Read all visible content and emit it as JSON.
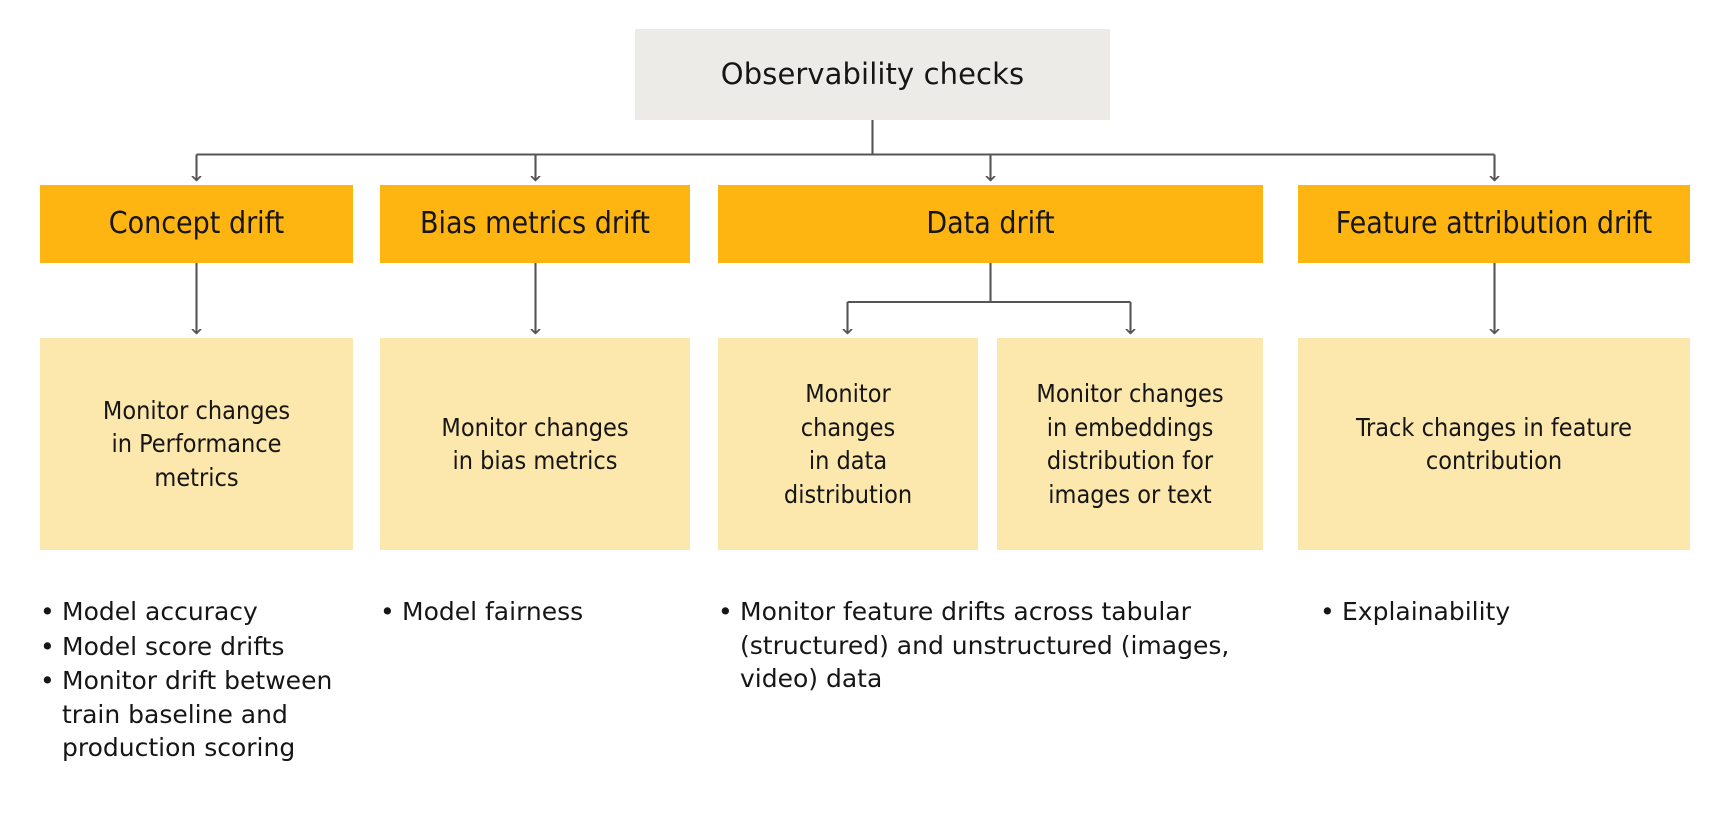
{
  "diagram": {
    "type": "hierarchy-tree",
    "root": {
      "label": "Observability checks",
      "fill": "#ecebe8"
    },
    "colors": {
      "root_fill": "#ecebe8",
      "level1_fill": "#ffb511",
      "level2_fill": "#fce7ad",
      "connector_stroke": "#555555",
      "text": "#161616",
      "background": "#ffffff"
    },
    "columns": [
      {
        "id": "concept-drift",
        "level1": "Concept drift",
        "level2": [
          "Monitor changes\nin Performance\nmetrics"
        ],
        "bullets": [
          "Model accuracy",
          "Model score drifts",
          "Monitor drift between train baseline and production scoring"
        ]
      },
      {
        "id": "bias-metrics-drift",
        "level1": "Bias metrics drift",
        "level2": [
          "Monitor changes\nin bias metrics"
        ],
        "bullets": [
          "Model fairness"
        ]
      },
      {
        "id": "data-drift",
        "level1": "Data drift",
        "level2": [
          "Monitor\nchanges\nin data\ndistribution",
          "Monitor changes\nin embeddings\ndistribution for\nimages or text"
        ],
        "bullets": [
          "Monitor feature drifts across tabular (structured) and unstructured (images, video) data"
        ]
      },
      {
        "id": "feature-attribution-drift",
        "level1": "Feature attribution drift",
        "level2": [
          "Track changes in feature\ncontribution"
        ],
        "bullets": [
          "Explainability"
        ]
      }
    ],
    "bullet_marker": "•"
  }
}
